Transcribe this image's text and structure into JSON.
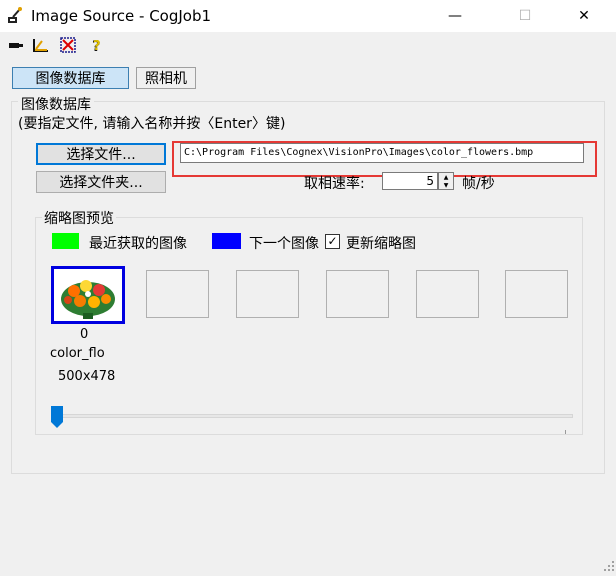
{
  "window": {
    "title": "Image Source - CogJob1",
    "minimize_glyph": "—",
    "maximize_glyph": "☐",
    "close_glyph": "✕"
  },
  "toolbar": {
    "icons": [
      "run-icon",
      "ruler-icon",
      "crosshair-icon",
      "help-icon"
    ]
  },
  "tabs": [
    {
      "label": "图像数据库",
      "selected": true
    },
    {
      "label": "照相机",
      "selected": false
    }
  ],
  "image_db": {
    "group_title": "图像数据库",
    "hint": "(要指定文件, 请输入名称并按〈Enter〉键)",
    "select_file_label": "选择文件...",
    "select_folder_label": "选择文件夹...",
    "path_value": "C:\\Program Files\\Cognex\\VisionPro\\Images\\color_flowers.bmp",
    "highlight_color": "#e53935"
  },
  "acquisition": {
    "rate_label": "取相速率:",
    "rate_value": "5",
    "rate_unit": "帧/秒"
  },
  "thumbnails": {
    "group_title": "缩略图预览",
    "last_label": "最近获取的图像",
    "last_color": "#00ff00",
    "next_label": "下一个图像",
    "next_color": "#0000ff",
    "update_label": "更新缩略图",
    "update_checked": true,
    "check_glyph": "✓",
    "items": [
      {
        "index": "0",
        "name": "color_flo",
        "size": "500x478"
      }
    ],
    "empty_slots": 5,
    "slider_position": 0
  }
}
